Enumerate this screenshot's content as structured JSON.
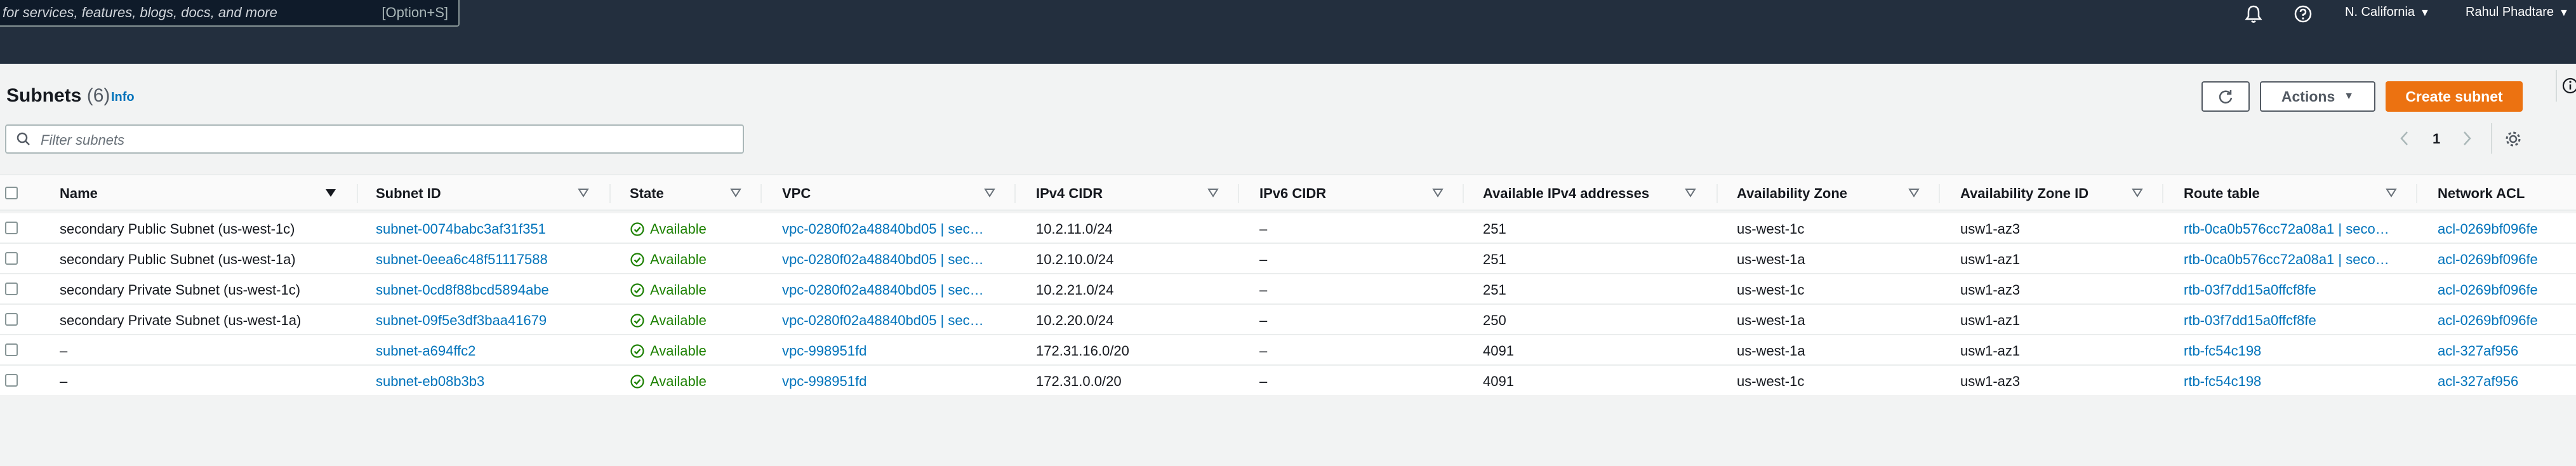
{
  "topnav": {
    "search_placeholder": "for services, features, blogs, docs, and more",
    "search_shortcut": "[Option+S]",
    "region": "N. California",
    "user": "Rahul Phadtare"
  },
  "header": {
    "title": "Subnets",
    "count": "(6)",
    "info": "Info",
    "actions_label": "Actions",
    "create_label": "Create subnet"
  },
  "filter": {
    "placeholder": "Filter subnets"
  },
  "pagination": {
    "page": "1"
  },
  "colors": {
    "accent": "#ec7211",
    "link": "#0073bb",
    "success": "#1d8102",
    "nav": "#232f3e"
  },
  "table": {
    "columns": [
      "Name",
      "Subnet ID",
      "State",
      "VPC",
      "IPv4 CIDR",
      "IPv6 CIDR",
      "Available IPv4 addresses",
      "Availability Zone",
      "Availability Zone ID",
      "Route table",
      "Network ACL"
    ],
    "rows": [
      {
        "name": "secondary Public Subnet (us-west-1c)",
        "subnet_id": "subnet-0074babc3af31f351",
        "state": "Available",
        "vpc": "vpc-0280f02a48840bd05 | sec…",
        "ipv4": "10.2.11.0/24",
        "ipv6": "–",
        "available": "251",
        "az": "us-west-1c",
        "az_id": "usw1-az3",
        "route": "rtb-0ca0b576cc72a08a1 | seco…",
        "acl": "acl-0269bf096fe"
      },
      {
        "name": "secondary Public Subnet (us-west-1a)",
        "subnet_id": "subnet-0eea6c48f51117588",
        "state": "Available",
        "vpc": "vpc-0280f02a48840bd05 | sec…",
        "ipv4": "10.2.10.0/24",
        "ipv6": "–",
        "available": "251",
        "az": "us-west-1a",
        "az_id": "usw1-az1",
        "route": "rtb-0ca0b576cc72a08a1 | seco…",
        "acl": "acl-0269bf096fe"
      },
      {
        "name": "secondary Private Subnet (us-west-1c)",
        "subnet_id": "subnet-0cd8f88bcd5894abe",
        "state": "Available",
        "vpc": "vpc-0280f02a48840bd05 | sec…",
        "ipv4": "10.2.21.0/24",
        "ipv6": "–",
        "available": "251",
        "az": "us-west-1c",
        "az_id": "usw1-az3",
        "route": "rtb-03f7dd15a0ffcf8fe",
        "acl": "acl-0269bf096fe"
      },
      {
        "name": "secondary Private Subnet (us-west-1a)",
        "subnet_id": "subnet-09f5e3df3baa41679",
        "state": "Available",
        "vpc": "vpc-0280f02a48840bd05 | sec…",
        "ipv4": "10.2.20.0/24",
        "ipv6": "–",
        "available": "250",
        "az": "us-west-1a",
        "az_id": "usw1-az1",
        "route": "rtb-03f7dd15a0ffcf8fe",
        "acl": "acl-0269bf096fe"
      },
      {
        "name": "–",
        "subnet_id": "subnet-a694ffc2",
        "state": "Available",
        "vpc": "vpc-998951fd",
        "ipv4": "172.31.16.0/20",
        "ipv6": "–",
        "available": "4091",
        "az": "us-west-1a",
        "az_id": "usw1-az1",
        "route": "rtb-fc54c198",
        "acl": "acl-327af956"
      },
      {
        "name": "–",
        "subnet_id": "subnet-eb08b3b3",
        "state": "Available",
        "vpc": "vpc-998951fd",
        "ipv4": "172.31.0.0/20",
        "ipv6": "–",
        "available": "4091",
        "az": "us-west-1c",
        "az_id": "usw1-az3",
        "route": "rtb-fc54c198",
        "acl": "acl-327af956"
      }
    ]
  }
}
